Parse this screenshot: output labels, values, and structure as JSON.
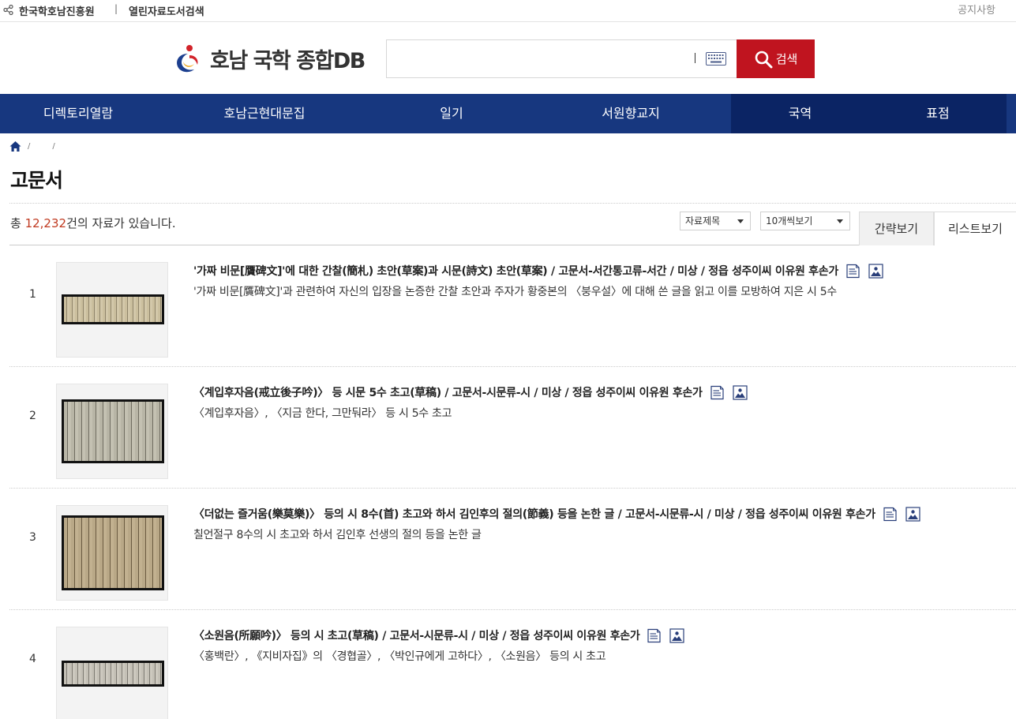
{
  "topbar": {
    "link1": "한국학호남진흥원",
    "separator": "|",
    "link2": "열린자료도서검색",
    "notice": "공지사항"
  },
  "header": {
    "logo_text": "호남 국학 종합DB",
    "search": {
      "value": "",
      "placeholder": ""
    },
    "search_button": "검색"
  },
  "nav": {
    "items": [
      {
        "label": "디렉토리열람"
      },
      {
        "label": "호남근현대문집"
      },
      {
        "label": "일기"
      },
      {
        "label": "서원향교지"
      },
      {
        "label": "국역",
        "active": true
      },
      {
        "label": "표점"
      }
    ]
  },
  "breadcrumb": {
    "sep": "/"
  },
  "page": {
    "title": "고문서"
  },
  "toolbar": {
    "total_prefix": "총 ",
    "total_count": "12,232",
    "total_suffix": "건의 자료가 있습니다.",
    "sort_select": "자료제목",
    "perpage_select": "10개씩보기",
    "view_simple": "간략보기",
    "view_list": "리스트보기"
  },
  "results": [
    {
      "index": "1",
      "title": "'가짜 비문[贋碑文]'에 대한 간찰(簡札) 초안(草案)과 시문(詩文) 초안(草案) / 고문서-서간통고류-서간 / 미상 / 정읍 성주이씨 이유원 후손가",
      "desc": "'가짜 비문[贋碑文]'과 관련하여 자신의 입장을 논증한 간찰 초안과 주자가 황중본의 〈붕우설〉에 대해 쓴 글을 읽고 이를 모방하여 지은 시 5수"
    },
    {
      "index": "2",
      "title": "〈계입후자음(戒立後子吟)〉 등 시문 5수 초고(草稿) / 고문서-시문류-시 / 미상 / 정읍 성주이씨 이유원 후손가",
      "desc": "〈계입후자음〉, 〈지금 한다, 그만둬라〉 등 시 5수 초고"
    },
    {
      "index": "3",
      "title": "〈더없는 즐거움(樂莫樂)〉 등의 시 8수(首) 초고와 하서 김인후의 절의(節義) 등을 논한 글 / 고문서-시문류-시 / 미상 / 정읍 성주이씨 이유원 후손가",
      "desc": "칠언절구 8수의 시 초고와 하서 김인후 선생의 절의 등을 논한 글"
    },
    {
      "index": "4",
      "title": "〈소원음(所願吟)〉 등의 시 초고(草稿) / 고문서-시문류-시 / 미상 / 정읍 성주이씨 이유원 후손가",
      "desc": "〈홍백란〉, 《지비자집》의 〈경협골〉, 〈박인규에게 고하다〉, 〈소원음〉 등의 시 초고"
    }
  ],
  "colors": {
    "nav_bg": "#17377f",
    "nav_active": "#0b2464",
    "search_button": "#c0141f",
    "count_accent": "#c0391f"
  },
  "icons": [
    "share-icon",
    "keyboard-icon",
    "search-icon",
    "home-icon",
    "document-text-icon",
    "image-view-icon"
  ]
}
